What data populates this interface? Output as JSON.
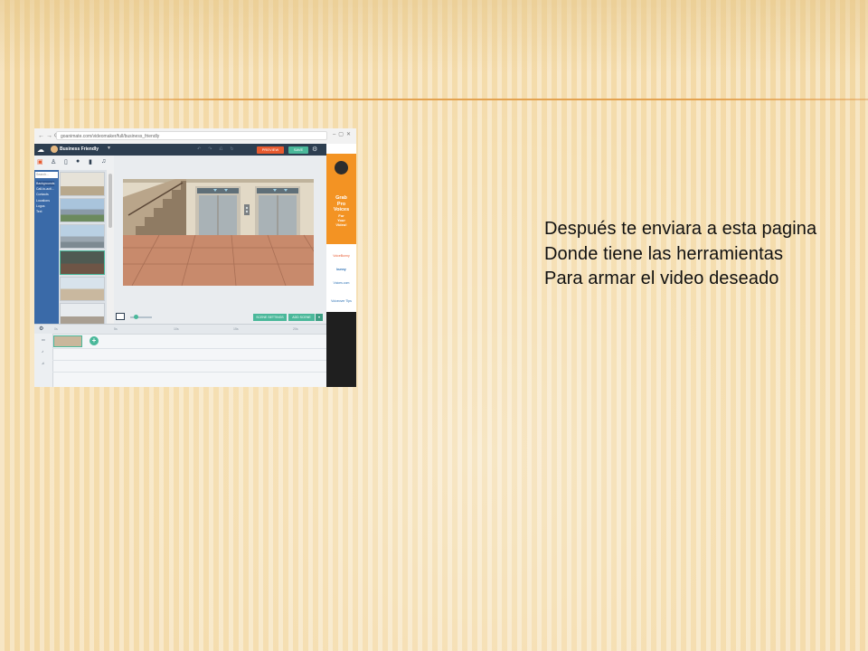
{
  "caption": {
    "lines": [
      "Después te enviara a esta pagina",
      "Donde tiene las herramientas",
      "Para armar el video deseado"
    ]
  },
  "screenshot": {
    "browser": {
      "url": "goanimate.com/videomaker/full/business_friendly"
    },
    "app": {
      "project_name": "Business Friendly",
      "preview_label": "PREVIEW",
      "save_label": "SAVE"
    },
    "sidebar": {
      "search_placeholder": "Search...",
      "categories": [
        "Backgrounds",
        "Call-to-acti...",
        "Contacts",
        "Locations",
        "Logos",
        "Text"
      ]
    },
    "canvas": {
      "scene_settings_label": "SCENE SETTINGS",
      "add_scene_label": "ADD SCENE"
    },
    "timeline": {
      "ticks": [
        "0s",
        "5s",
        "10s",
        "15s",
        "20s"
      ]
    },
    "ad": {
      "headline": [
        "Grab",
        "Pro",
        "Voices"
      ],
      "subline": [
        "For",
        "Your",
        "Video!"
      ],
      "logos": [
        "VoiceBunny",
        "bunny",
        "Voices.com",
        "Voiceover Tips"
      ]
    },
    "colors": {
      "app_bar": "#2d3e50",
      "accent_orange": "#e85a2f",
      "accent_green": "#4ab89a",
      "sidebar_blue": "#3a6aa8",
      "ad_orange": "#f39323"
    }
  }
}
